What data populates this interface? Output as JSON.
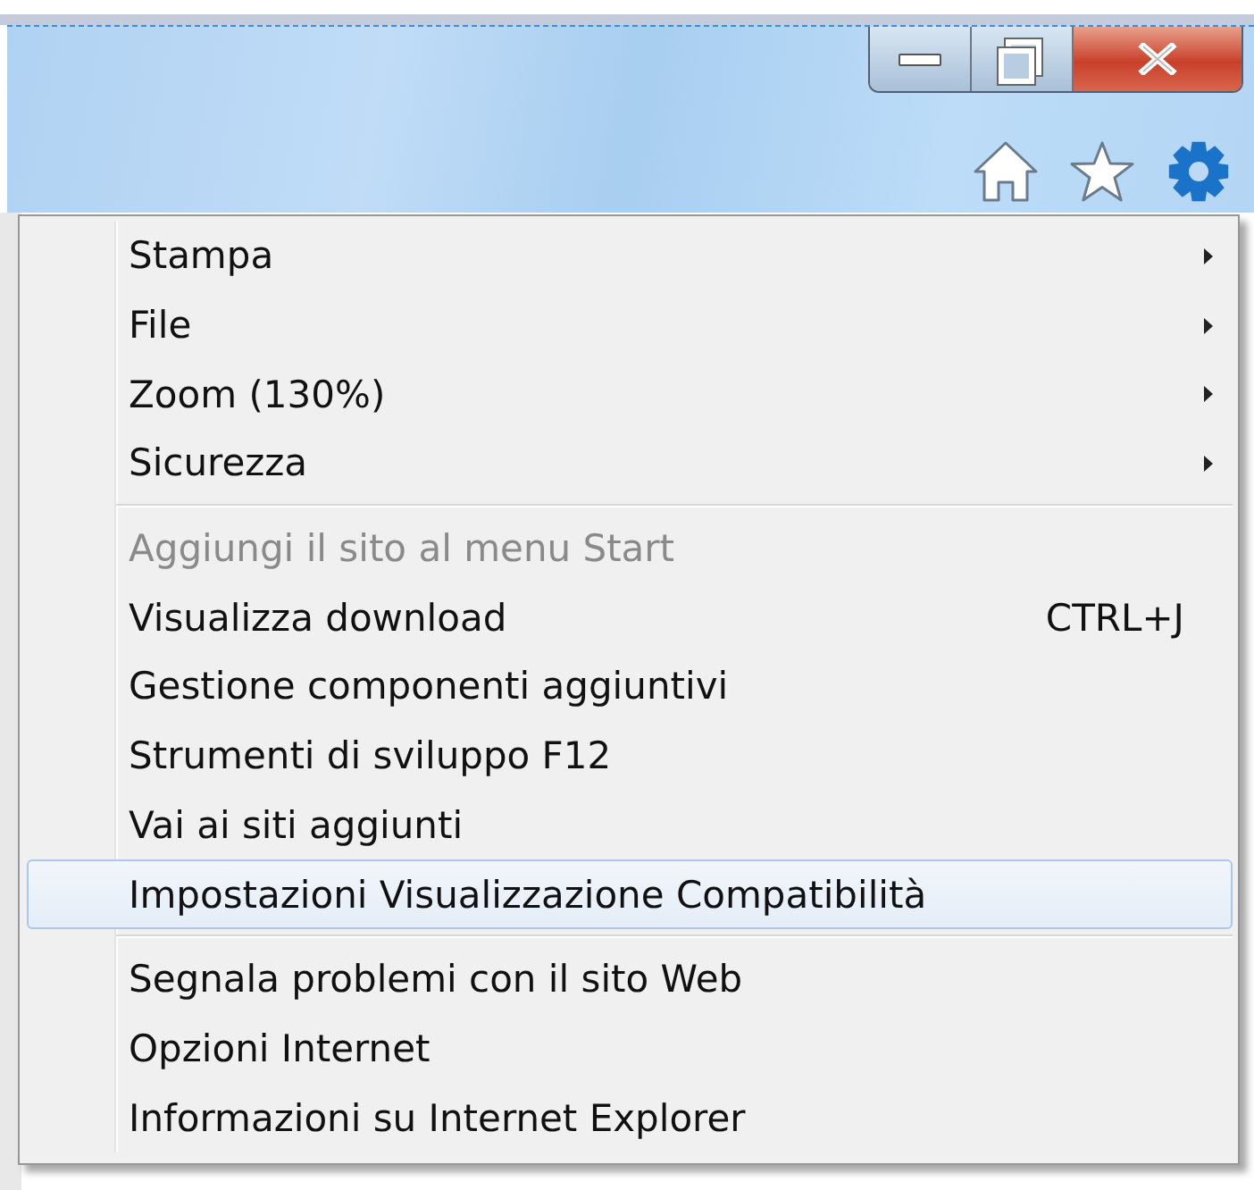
{
  "menu": {
    "sections": [
      {
        "items": [
          {
            "label": "Stampa",
            "submenu": true,
            "disabled": false,
            "selected": false
          },
          {
            "label": "File",
            "submenu": true,
            "disabled": false,
            "selected": false
          },
          {
            "label": "Zoom (130%)",
            "submenu": true,
            "disabled": false,
            "selected": false
          },
          {
            "label": "Sicurezza",
            "submenu": true,
            "disabled": false,
            "selected": false
          }
        ]
      },
      {
        "items": [
          {
            "label": "Aggiungi il sito al menu Start",
            "submenu": false,
            "disabled": true,
            "selected": false
          },
          {
            "label": "Visualizza download",
            "shortcut": "CTRL+J",
            "submenu": false,
            "disabled": false,
            "selected": false
          },
          {
            "label": "Gestione componenti aggiuntivi",
            "submenu": false,
            "disabled": false,
            "selected": false
          },
          {
            "label": "Strumenti di sviluppo F12",
            "submenu": false,
            "disabled": false,
            "selected": false
          },
          {
            "label": "Vai ai siti aggiunti",
            "submenu": false,
            "disabled": false,
            "selected": false
          },
          {
            "label": "Impostazioni Visualizzazione Compatibilità",
            "submenu": false,
            "disabled": false,
            "selected": true
          }
        ]
      },
      {
        "items": [
          {
            "label": "Segnala problemi con il sito Web",
            "submenu": false,
            "disabled": false,
            "selected": false
          },
          {
            "label": "Opzioni Internet",
            "submenu": false,
            "disabled": false,
            "selected": false
          },
          {
            "label": "Informazioni su Internet Explorer",
            "submenu": false,
            "disabled": false,
            "selected": false
          }
        ]
      }
    ]
  }
}
